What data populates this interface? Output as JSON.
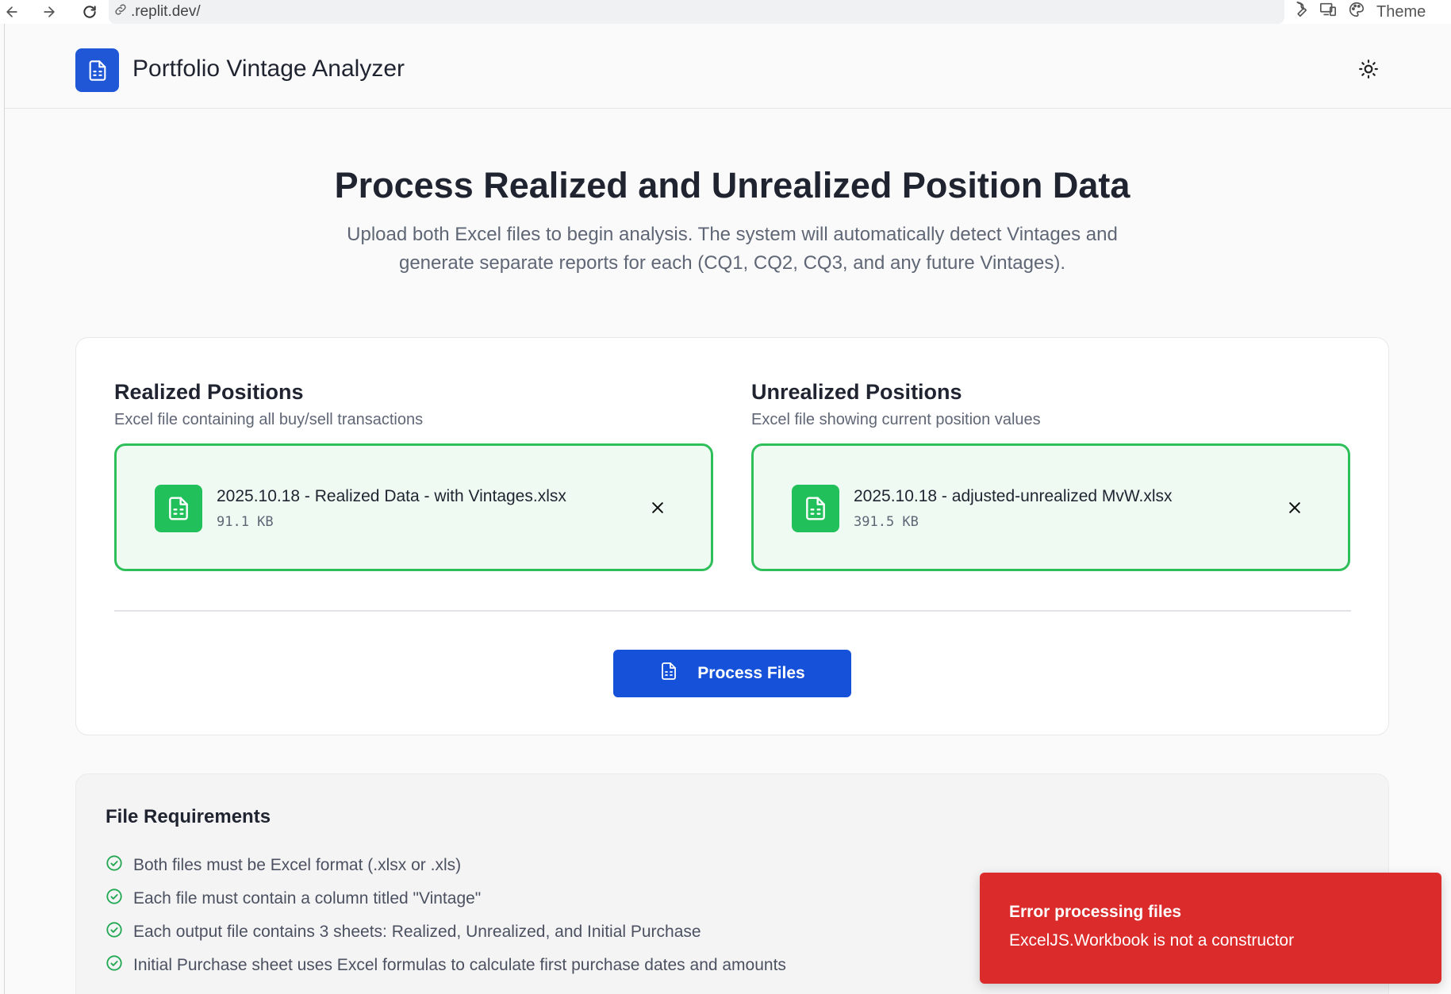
{
  "browser": {
    "url": ".replit.dev/",
    "theme_label": "Theme",
    "icons": [
      "back-arrow-icon",
      "forward-arrow-icon",
      "reload-icon",
      "link-icon",
      "wrench-icon",
      "devices-icon",
      "palette-icon"
    ]
  },
  "header": {
    "app_title": "Portfolio Vintage Analyzer",
    "logo_icon": "document-icon",
    "theme_icon": "sun-icon"
  },
  "hero": {
    "title": "Process Realized and Unrealized Position Data",
    "subtitle": "Upload both Excel files to begin analysis. The system will automatically detect Vintages and generate separate reports for each (CQ1, CQ2, CQ3, and any future Vintages)."
  },
  "upload": {
    "realized": {
      "heading": "Realized Positions",
      "description": "Excel file containing all buy/sell transactions",
      "file_name": "2025.10.18 - Realized Data - with Vintages.xlsx",
      "file_size": "91.1 KB"
    },
    "unrealized": {
      "heading": "Unrealized Positions",
      "description": "Excel file showing current position values",
      "file_name": "2025.10.18 - adjusted-unrealized MvW.xlsx",
      "file_size": "391.5 KB"
    },
    "process_button_label": "Process Files"
  },
  "requirements": {
    "title": "File Requirements",
    "items": [
      "Both files must be Excel format (.xlsx or .xls)",
      "Each file must contain a column titled \"Vintage\"",
      "Each output file contains 3 sheets: Realized, Unrealized, and Initial Purchase",
      "Initial Purchase sheet uses Excel formulas to calculate first purchase dates and amounts"
    ]
  },
  "toast": {
    "title": "Error processing files",
    "message": "ExcelJS.Workbook is not a constructor"
  },
  "colors": {
    "brand_blue": "#1f57d6",
    "button_blue": "#1552d9",
    "success_green": "#22c05a",
    "file_box_bg": "#effaf3",
    "error_red": "#dc2b2b"
  }
}
